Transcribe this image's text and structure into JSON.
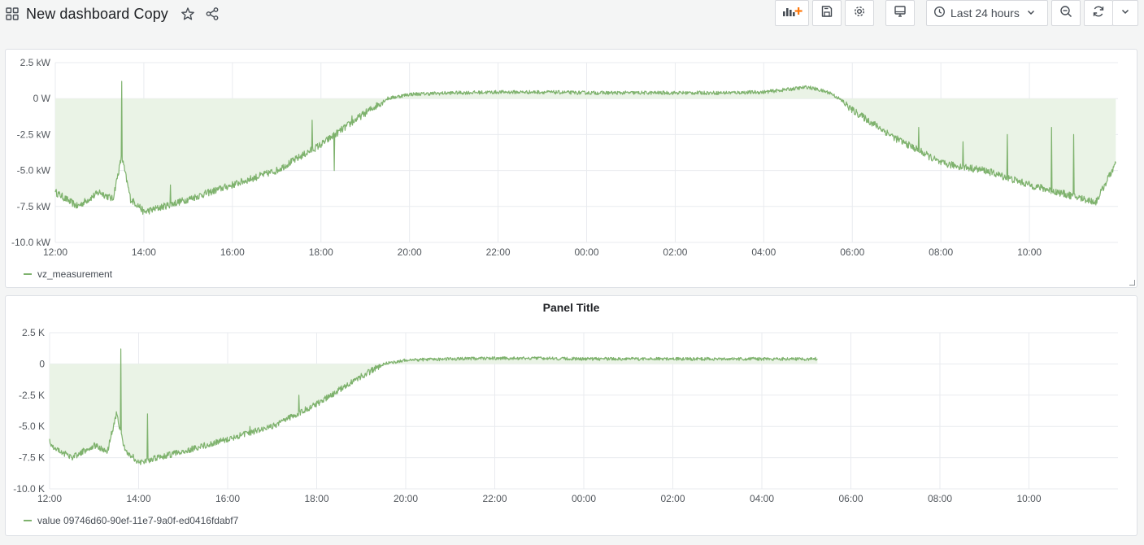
{
  "header": {
    "title": "New dashboard Copy",
    "icons": [
      "apps-icon",
      "star-icon",
      "share-icon"
    ]
  },
  "toolbar": {
    "buttons": [
      "add-panel",
      "save-dashboard",
      "settings",
      "cycle-view-mode",
      "zoom-out",
      "refresh",
      "refresh-interval"
    ],
    "time_range_label": "Last 24 hours"
  },
  "colors": {
    "series": "#7eb26d",
    "series_fill": "#eaf3e6",
    "accent": "#ff780a",
    "panel_bg": "#ffffff",
    "page_bg": "#f4f5f5",
    "grid": "#e9ebef"
  },
  "chart_data": [
    {
      "type": "area",
      "title": "",
      "x_ticks": [
        "12:00",
        "14:00",
        "16:00",
        "18:00",
        "20:00",
        "22:00",
        "00:00",
        "02:00",
        "04:00",
        "06:00",
        "08:00",
        "10:00"
      ],
      "y_ticks": [
        "2.5 kW",
        "0 W",
        "-2.5 kW",
        "-5.0 kW",
        "-7.5 kW",
        "-10.0 kW"
      ],
      "ylim": [
        -10000,
        2500
      ],
      "xlim_hours": [
        0,
        24
      ],
      "grid": true,
      "legend_position": "bottom-left",
      "series": [
        {
          "name": "vz_measurement",
          "x": [
            0.0,
            0.5,
            1.0,
            1.3,
            1.5,
            1.7,
            1.9,
            2.0,
            3.0,
            4.0,
            5.0,
            6.0,
            7.0,
            7.5,
            8.0,
            9.0,
            10.0,
            11.0,
            12.0,
            13.0,
            14.0,
            15.0,
            16.0,
            17.0,
            17.5,
            17.7,
            18.0,
            18.5,
            19.0,
            19.5,
            20.0,
            21.0,
            22.0,
            23.0,
            23.5,
            23.95
          ],
          "values": [
            -6500,
            -7500,
            -6500,
            -7000,
            -4000,
            -7000,
            -7500,
            -7900,
            -7000,
            -6000,
            -5000,
            -3200,
            -1000,
            0,
            300,
            400,
            450,
            450,
            400,
            400,
            400,
            400,
            450,
            800,
            400,
            0,
            -800,
            -1800,
            -2800,
            -3600,
            -4500,
            -5000,
            -6000,
            -6800,
            -7200,
            -4500
          ]
        }
      ],
      "annotations": [
        {
          "x": 0.0,
          "value": -6500
        },
        {
          "x": 1.5,
          "value": 1200
        },
        {
          "x": 2.6,
          "value": -6000
        },
        {
          "x": 5.8,
          "value": -1500
        },
        {
          "x": 6.3,
          "value": -5000
        },
        {
          "x": 6.7,
          "value": -1200
        },
        {
          "x": 19.5,
          "value": -2000
        },
        {
          "x": 20.5,
          "value": -3000
        },
        {
          "x": 21.5,
          "value": -2500
        },
        {
          "x": 22.5,
          "value": -2000
        },
        {
          "x": 23.0,
          "value": -2500
        }
      ]
    },
    {
      "type": "area",
      "title": "Panel Title",
      "x_ticks": [
        "12:00",
        "14:00",
        "16:00",
        "18:00",
        "20:00",
        "22:00",
        "00:00",
        "02:00",
        "04:00",
        "06:00",
        "08:00",
        "10:00"
      ],
      "y_ticks": [
        "2.5 K",
        "0",
        "-2.5 K",
        "-5.0 K",
        "-7.5 K",
        "-10.0 K"
      ],
      "ylim": [
        -10000,
        2500
      ],
      "xlim_hours": [
        0,
        24
      ],
      "grid": true,
      "legend_position": "bottom-left",
      "series": [
        {
          "name": "value 09746d60-90ef-11e7-9a0f-ed0416fdabf7",
          "x": [
            0.0,
            0.5,
            1.0,
            1.3,
            1.5,
            1.7,
            1.9,
            2.0,
            3.0,
            4.0,
            5.0,
            6.0,
            7.0,
            7.5,
            8.0,
            9.0,
            10.0,
            11.0,
            12.0,
            13.0,
            14.0,
            15.0,
            16.0,
            17.25
          ],
          "values": [
            -6500,
            -7500,
            -6500,
            -7000,
            -4000,
            -7000,
            -7500,
            -7900,
            -7000,
            -6000,
            -5000,
            -3200,
            -1000,
            0,
            300,
            400,
            450,
            450,
            400,
            400,
            400,
            400,
            400,
            400
          ]
        }
      ],
      "annotations": [
        {
          "x": 0.0,
          "value": -6000
        },
        {
          "x": 1.6,
          "value": 1200
        },
        {
          "x": 2.2,
          "value": -4000
        },
        {
          "x": 4.5,
          "value": -5000
        },
        {
          "x": 5.6,
          "value": -2500
        },
        {
          "x": 6.0,
          "value": -3000
        }
      ]
    }
  ],
  "panels": [
    {
      "title": "",
      "legend_label": "vz_measurement",
      "y_ticks": [
        "2.5 kW",
        "0 W",
        "-2.5 kW",
        "-5.0 kW",
        "-7.5 kW",
        "-10.0 kW"
      ],
      "x_ticks": [
        "12:00",
        "14:00",
        "16:00",
        "18:00",
        "20:00",
        "22:00",
        "00:00",
        "02:00",
        "04:00",
        "06:00",
        "08:00",
        "10:00"
      ]
    },
    {
      "title": "Panel Title",
      "legend_label": "value 09746d60-90ef-11e7-9a0f-ed0416fdabf7",
      "y_ticks": [
        "2.5 K",
        "0",
        "-2.5 K",
        "-5.0 K",
        "-7.5 K",
        "-10.0 K"
      ],
      "x_ticks": [
        "12:00",
        "14:00",
        "16:00",
        "18:00",
        "20:00",
        "22:00",
        "00:00",
        "02:00",
        "04:00",
        "06:00",
        "08:00",
        "10:00"
      ]
    }
  ]
}
